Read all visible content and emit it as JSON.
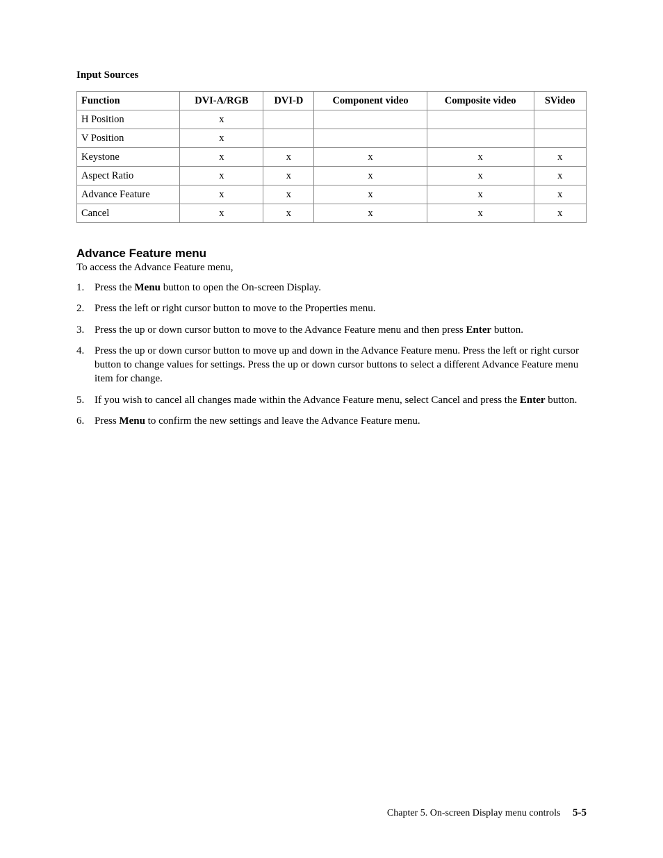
{
  "section_title": "Input Sources",
  "table": {
    "headers": [
      "Function",
      "DVI-A/RGB",
      "DVI-D",
      "Component video",
      "Composite video",
      "SVideo"
    ],
    "rows": [
      {
        "cells": [
          "H Position",
          "x",
          "",
          "",
          "",
          ""
        ]
      },
      {
        "cells": [
          "V Position",
          "x",
          "",
          "",
          "",
          ""
        ]
      },
      {
        "cells": [
          "Keystone",
          "x",
          "x",
          "x",
          "x",
          "x"
        ]
      },
      {
        "cells": [
          "Aspect Ratio",
          "x",
          "x",
          "x",
          "x",
          "x"
        ]
      },
      {
        "cells": [
          "Advance Feature",
          "x",
          "x",
          "x",
          "x",
          "x"
        ]
      },
      {
        "cells": [
          "Cancel",
          "x",
          "x",
          "x",
          "x",
          "x"
        ]
      }
    ]
  },
  "heading2": "Advance Feature menu",
  "intro": "To access the Advance Feature menu,",
  "steps": [
    {
      "pre": "Press the ",
      "bold": "Menu",
      "post": " button to open the On-screen Display."
    },
    {
      "pre": "Press the left or right cursor button to move to the Properties menu.",
      "bold": "",
      "post": ""
    },
    {
      "pre": "Press the up or down cursor button to move to the Advance Feature menu and then press ",
      "bold": "Enter",
      "post": " button."
    },
    {
      "pre": "Press the up or down cursor button to move up and down in the Advance Feature menu. Press the left or right cursor button to change values for settings. Press the up or down cursor buttons to select a different Advance Feature menu item for change.",
      "bold": "",
      "post": ""
    },
    {
      "pre": "If you wish to cancel all changes made within the Advance Feature menu, select Cancel and press the ",
      "bold": "Enter",
      "post": " button."
    },
    {
      "pre": "Press ",
      "bold": "Menu",
      "post": " to confirm the new settings and leave the Advance Feature menu."
    }
  ],
  "footer": {
    "chapter": "Chapter 5. On-screen Display menu controls",
    "page": "5-5"
  }
}
